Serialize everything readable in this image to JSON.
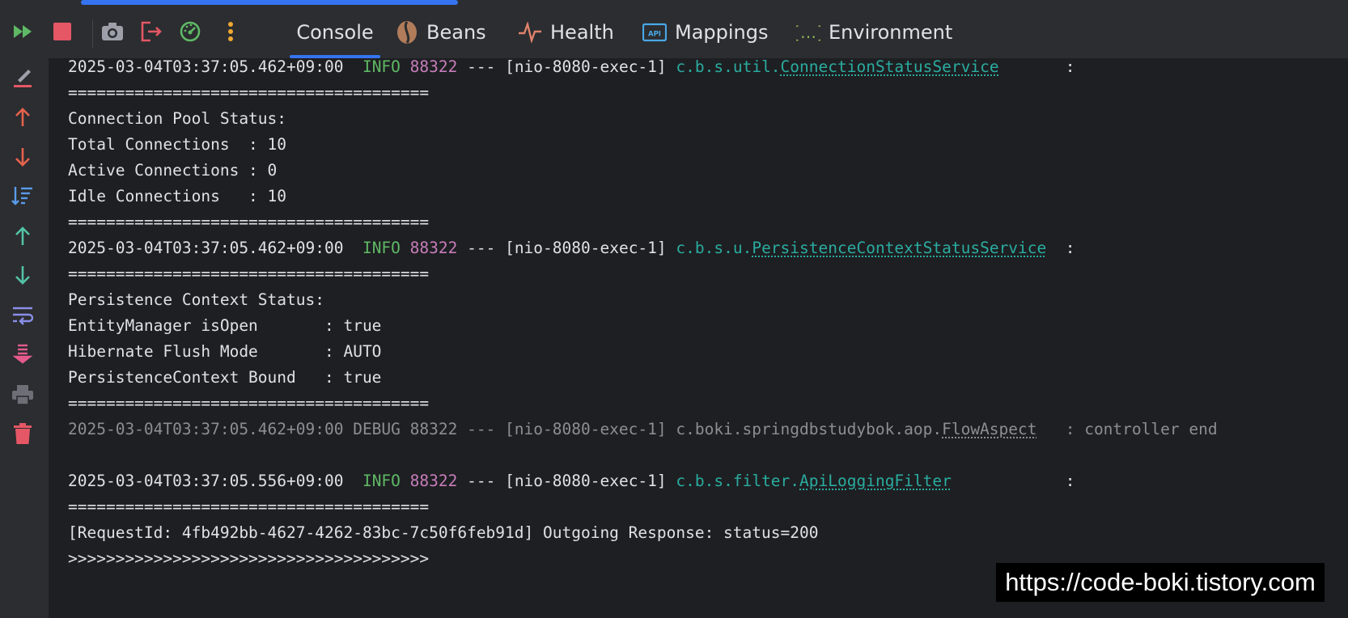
{
  "toolbar": {
    "buttons": [
      "rerun-icon",
      "stop-icon",
      "screenshot-icon",
      "exit-icon",
      "speedometer-icon",
      "more-icon"
    ],
    "tabs": [
      {
        "label": "Console",
        "icon": "console",
        "active": true
      },
      {
        "label": "Beans",
        "icon": "bean-icon"
      },
      {
        "label": "Health",
        "icon": "pulse-icon"
      },
      {
        "label": "Mappings",
        "icon": "api-icon"
      },
      {
        "label": "Environment",
        "icon": "braces-icon"
      }
    ]
  },
  "sidebar": {
    "buttons": [
      "clear-icon",
      "up-red-icon",
      "down-red-icon",
      "sort-icon",
      "up-teal-icon",
      "down-teal-icon",
      "wrap-icon",
      "scroll-end-icon",
      "print-icon",
      "trash-icon"
    ]
  },
  "console": {
    "l1": {
      "ts": "2025-03-04T03:37:05.462+09:00  ",
      "level": "INFO",
      "pid": "88322",
      "mid": " --- [nio-8080-exec-1] ",
      "pkg": "c.b.s.util.",
      "cls": "ConnectionStatusService",
      "tail": "       :"
    },
    "l2": "======================================",
    "l3": "Connection Pool Status:",
    "l4": "Total Connections  : 10",
    "l5": "Active Connections : 0",
    "l6": "Idle Connections   : 10",
    "l7": "======================================",
    "l8": {
      "ts": "2025-03-04T03:37:05.462+09:00  ",
      "level": "INFO",
      "pid": "88322",
      "mid": " --- [nio-8080-exec-1] ",
      "pkg": "c.b.s.u.",
      "cls": "PersistenceContextStatusService",
      "tail": "  :"
    },
    "l9": "======================================",
    "l10": "Persistence Context Status:",
    "l11": "EntityManager isOpen       : true",
    "l12": "Hibernate Flush Mode       : AUTO",
    "l13": "PersistenceContext Bound   : true",
    "l14": "======================================",
    "l15": {
      "pre": "2025-03-04T03:37:05.462+09:00 DEBUG 88322 --- [nio-8080-exec-1] c.boki.springdbstudybok.aop.",
      "cls": "FlowAspect",
      "tail": "   : controller end"
    },
    "l17": {
      "ts": "2025-03-04T03:37:05.556+09:00  ",
      "level": "INFO",
      "pid": "88322",
      "mid": " --- [nio-8080-exec-1] ",
      "pkg": "c.b.s.filter.",
      "cls": "ApiLoggingFilter",
      "tail": "            :"
    },
    "l18": "======================================",
    "l19": "[RequestId: 4fb492bb-4627-4262-83bc-7c50f6feb91d] Outgoing Response: status=200",
    "l20": ">>>>>>>>>>>>>>>>>>>>>>>>>>>>>>>>>>>>>>"
  },
  "watermark": "https://code-boki.tistory.com",
  "colors": {
    "accent": "#3574f0",
    "info": "#5fb865",
    "pid": "#c77dbb",
    "logger": "#2aaca0"
  }
}
